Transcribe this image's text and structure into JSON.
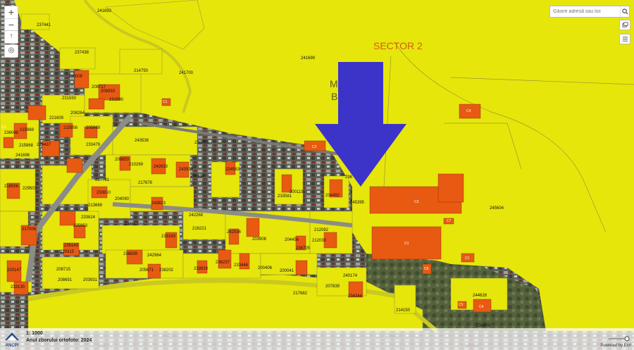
{
  "map": {
    "district_label": "SECTOR 2",
    "municipality_label_top": "M        UL",
    "municipality_label_bottom": "B          TI",
    "parcels": [
      "241693",
      "237441",
      "237438",
      "241699",
      "241700",
      "214750",
      "215009",
      "208717",
      "208933",
      "231550",
      "231890",
      "215969",
      "221609",
      "208264",
      "205869",
      "215956",
      "236048",
      "215868",
      "229437",
      "233479",
      "243538",
      "236055",
      "208853",
      "210269",
      "242633",
      "243533",
      "236054",
      "224563",
      "236",
      "241696",
      "218556",
      "229503",
      "227781",
      "233810",
      "217678",
      "200119",
      "233581",
      "234492",
      "245395",
      "245604",
      "213669",
      "204090",
      "243823",
      "233824",
      "225953",
      "204357",
      "242268",
      "216221",
      "215163",
      "242536",
      "203908",
      "212082",
      "204456",
      "212030",
      "217006",
      "235143",
      "229315",
      "238705",
      "236839",
      "242964",
      "236237",
      "233446",
      "205671",
      "238202",
      "233919",
      "200406",
      "200041",
      "240174",
      "220147",
      "208715",
      "208691",
      "203931",
      "233130",
      "207839",
      "234344",
      "214150",
      "244628",
      "217682",
      "238062",
      "246822",
      "234803",
      "24362",
      "243554"
    ],
    "construction_labels": [
      "C1",
      "C1",
      "C4",
      "C3",
      "C2",
      "C7",
      "C1",
      "C6",
      "C1",
      "C5",
      "C4"
    ]
  },
  "search": {
    "placeholder": "Găsire adresă sau loc"
  },
  "footer": {
    "scale": "1: 1000",
    "ortho": "Anul zborului ortofoto: 2024",
    "logo_text": "ANCPI",
    "powered": "Powered by Esri"
  },
  "colors": {
    "parcel_yellow": "#e6e60a",
    "building_orange": "#e85a12",
    "arrow_blue": "#3c34c8",
    "district_text": "#d55e12"
  },
  "icons": [
    "zoom-in-icon",
    "zoom-out-icon",
    "north-arrow-icon",
    "locate-icon",
    "search-icon",
    "layers-icon",
    "list-icon",
    "ancpi-logo"
  ]
}
